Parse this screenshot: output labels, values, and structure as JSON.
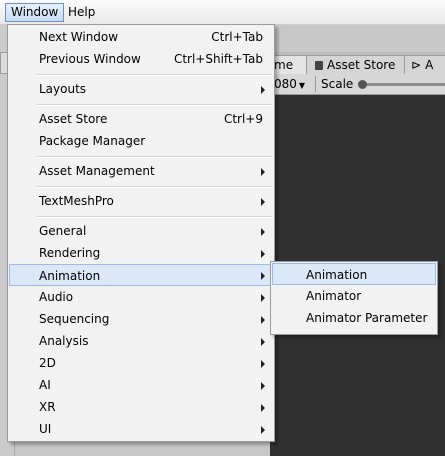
{
  "menubar": {
    "window_label": "Window",
    "help_label": "Help"
  },
  "background": {
    "tab_game_partial": "me",
    "tab_asset_store": "Asset Store",
    "tab_partial_right": "A",
    "resolution_partial": "080",
    "scale_label": "Scale"
  },
  "window_menu": {
    "items": [
      {
        "label": "Next Window",
        "shortcut": "Ctrl+Tab"
      },
      {
        "label": "Previous Window",
        "shortcut": "Ctrl+Shift+Tab"
      },
      {
        "label": "Layouts",
        "submenu": true
      },
      {
        "label": "Asset Store",
        "shortcut": "Ctrl+9"
      },
      {
        "label": "Package Manager"
      },
      {
        "label": "Asset Management",
        "submenu": true
      },
      {
        "label": "TextMeshPro",
        "submenu": true
      },
      {
        "label": "General",
        "submenu": true
      },
      {
        "label": "Rendering",
        "submenu": true
      },
      {
        "label": "Animation",
        "submenu": true,
        "highlighted": true
      },
      {
        "label": "Audio",
        "submenu": true
      },
      {
        "label": "Sequencing",
        "submenu": true
      },
      {
        "label": "Analysis",
        "submenu": true
      },
      {
        "label": "2D",
        "submenu": true
      },
      {
        "label": "AI",
        "submenu": true
      },
      {
        "label": "XR",
        "submenu": true
      },
      {
        "label": "UI",
        "submenu": true
      }
    ]
  },
  "animation_submenu": {
    "items": [
      {
        "label": "Animation",
        "highlighted": true
      },
      {
        "label": "Animator"
      },
      {
        "label": "Animator Parameter"
      }
    ]
  }
}
